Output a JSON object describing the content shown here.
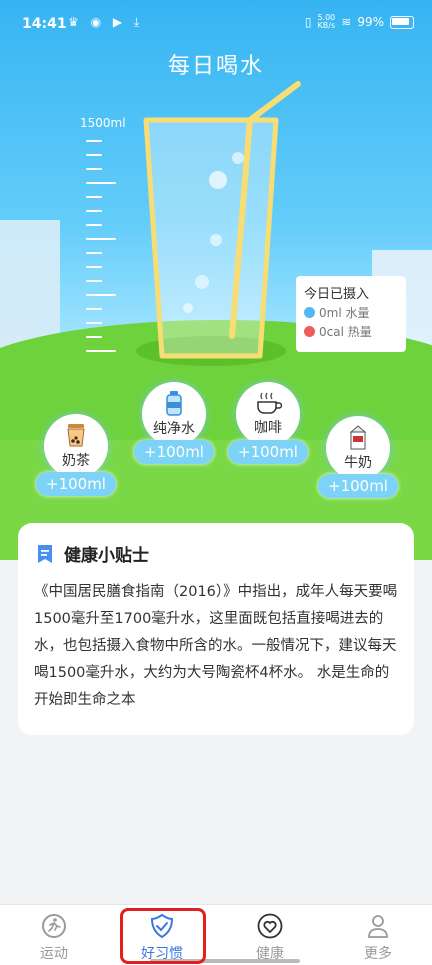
{
  "status_bar": {
    "time": "14:41",
    "net_speed_value": "5.00",
    "net_speed_unit": "KB/s",
    "battery": "99%"
  },
  "page_title": "每日喝水",
  "scale_label": "1500ml",
  "intake": {
    "title": "今日已摄入",
    "water": "0ml 水量",
    "calories": "0cal 热量",
    "water_color": "#53b8f3",
    "calorie_color": "#f05a5a"
  },
  "drinks": [
    {
      "label": "奶茶",
      "amount": "+100ml",
      "icon": "milk-tea-icon"
    },
    {
      "label": "纯净水",
      "amount": "+100ml",
      "icon": "water-bottle-icon"
    },
    {
      "label": "咖啡",
      "amount": "+100ml",
      "icon": "coffee-icon"
    },
    {
      "label": "牛奶",
      "amount": "+100ml",
      "icon": "milk-carton-icon"
    }
  ],
  "tips": {
    "title": "健康小贴士",
    "body": "《中国居民膳食指南（2016）》中指出，成年人每天要喝1500毫升至1700毫升水，这里面既包括直接喝进去的水，也包括摄入食物中所含的水。一般情况下，建议每天喝1500毫升水，大约为大号陶瓷杯4杯水。 水是生命的开始即生命之本"
  },
  "tabs": [
    {
      "label": "运动",
      "icon": "running-icon",
      "active": false
    },
    {
      "label": "好习惯",
      "icon": "check-shield-icon",
      "active": true
    },
    {
      "label": "健康",
      "icon": "heart-icon",
      "active": false
    },
    {
      "label": "更多",
      "icon": "person-icon",
      "active": false
    }
  ],
  "accent_color": "#3a78e6"
}
